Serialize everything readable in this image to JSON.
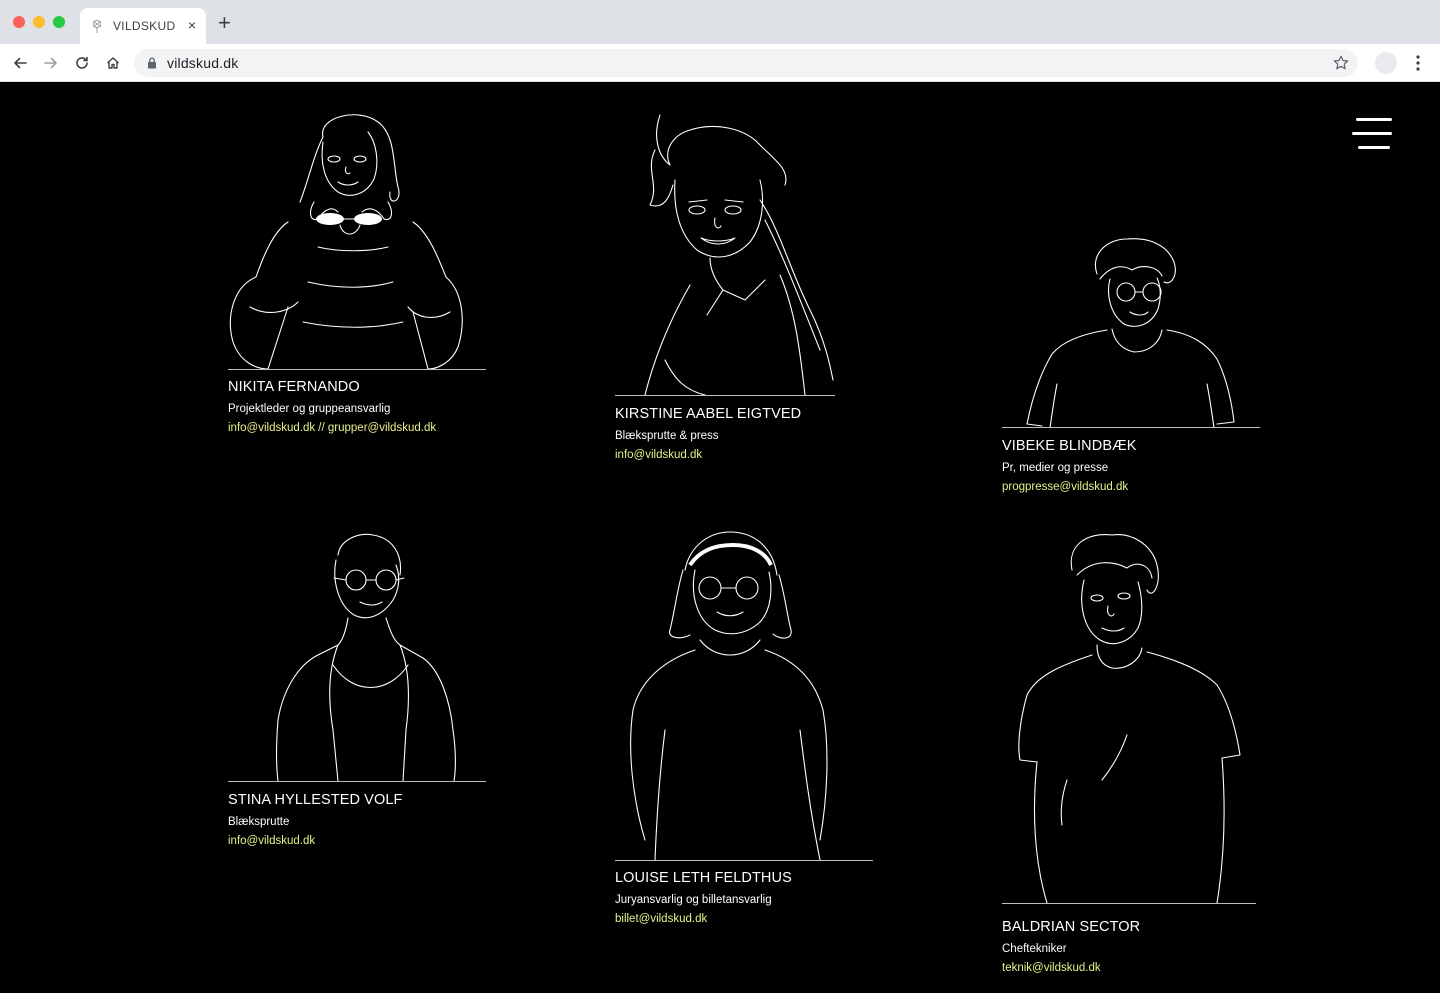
{
  "browser": {
    "tab_title": "VILDSKUD",
    "tab_close": "×",
    "new_tab": "+",
    "url": "vildskud.dk"
  },
  "icons": {
    "back": "back-arrow-icon",
    "forward": "forward-arrow-icon",
    "reload": "reload-icon",
    "home": "home-icon",
    "lock": "lock-icon",
    "bookmark": "star-icon",
    "menu": "hamburger-menu-icon"
  },
  "colors": {
    "background": "#000000",
    "text": "#ffffff",
    "email": "#e8f08a"
  },
  "team": [
    {
      "name": "NIKITA FERNANDO",
      "role": "Projektleder og gruppeansvarlig",
      "email": "info@vildskud.dk // grupper@vildskud.dk"
    },
    {
      "name": "KIRSTINE AABEL EIGTVED",
      "role": "Blæksprutte & press",
      "email": "info@vildskud.dk"
    },
    {
      "name": "VIBEKE BLINDBÆK",
      "role": "Pr, medier og presse",
      "email": "progpresse@vildskud.dk"
    },
    {
      "name": "STINA HYLLESTED VOLF",
      "role": "Blæksprutte",
      "email": "info@vildskud.dk"
    },
    {
      "name": "LOUISE LETH FELDTHUS",
      "role": "Juryansvarlig og billetansvarlig",
      "email": "billet@vildskud.dk"
    },
    {
      "name": "BALDRIAN SECTOR",
      "role": "Cheftekniker",
      "email": "teknik@vildskud.dk"
    }
  ]
}
